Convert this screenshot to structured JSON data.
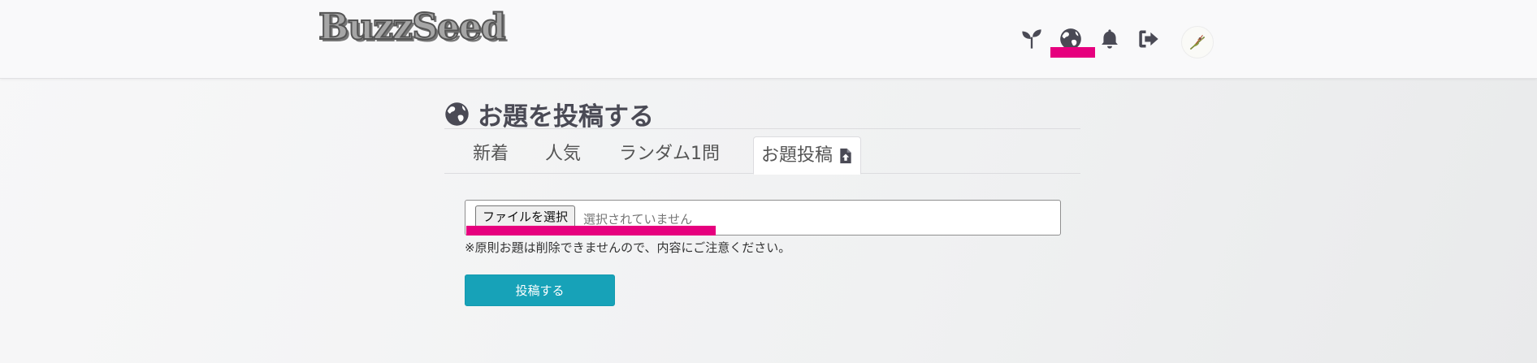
{
  "header": {
    "logo_text": "BuzzSeed",
    "icons": [
      "sprout-icon",
      "globe-icon",
      "bell-icon",
      "logout-icon"
    ],
    "avatar": "avatar"
  },
  "page": {
    "title": "お題を投稿する",
    "title_icon": "globe-icon"
  },
  "tabs": [
    {
      "label": "新着"
    },
    {
      "label": "人気"
    },
    {
      "label": "ランダム1問"
    },
    {
      "label": "お題投稿",
      "active": true,
      "icon": "file-upload-icon"
    }
  ],
  "form": {
    "file_button_label": "ファイルを選択",
    "file_status": "選択されていません",
    "note": "※原則お題は削除できませんので、内容にご注意ください。",
    "submit_label": "投稿する"
  },
  "colors": {
    "highlight": "#e6007e",
    "submit_button": "#17a2b8",
    "icon": "#4a4a55"
  }
}
